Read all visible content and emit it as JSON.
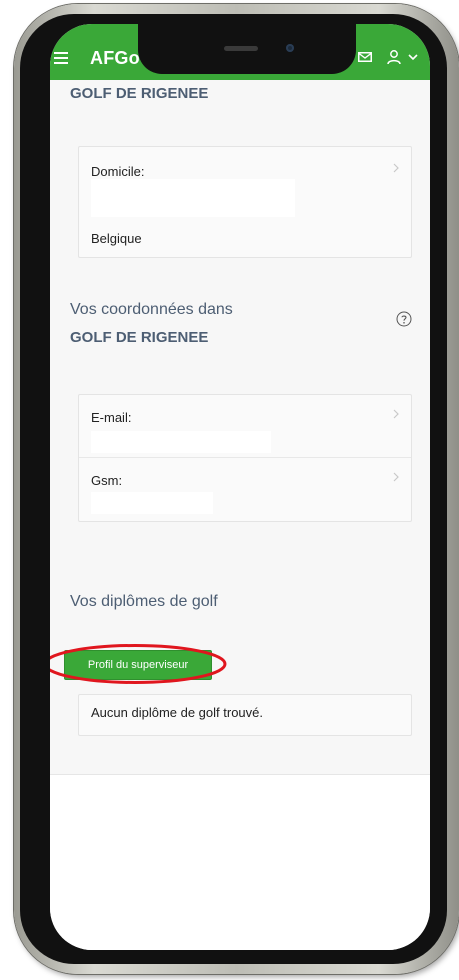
{
  "app": {
    "title": "AFGo",
    "brand_color": "#3aa838"
  },
  "icons": {
    "menu": "hamburger-menu-icon",
    "mail": "mail-icon",
    "user": "user-icon",
    "chevron": "chevron-down-icon",
    "row_chevron": "chevron-right-icon",
    "help": "help-circle-icon"
  },
  "club_section": {
    "heading": "GOLF DE RIGENEE",
    "address_card": {
      "label": "Domicile:",
      "country": "Belgique"
    }
  },
  "contact_section": {
    "heading_line1": "Vos coordonnées dans",
    "heading_line2": "GOLF DE RIGENEE",
    "rows": [
      {
        "label": "E-mail:"
      },
      {
        "label": "Gsm:"
      }
    ]
  },
  "diplomas_section": {
    "heading": "Vos diplômes de golf",
    "supervisor_button": "Profil du superviseur",
    "empty_message": "Aucun diplôme de golf trouvé.",
    "highlight_color": "#e0161e"
  }
}
